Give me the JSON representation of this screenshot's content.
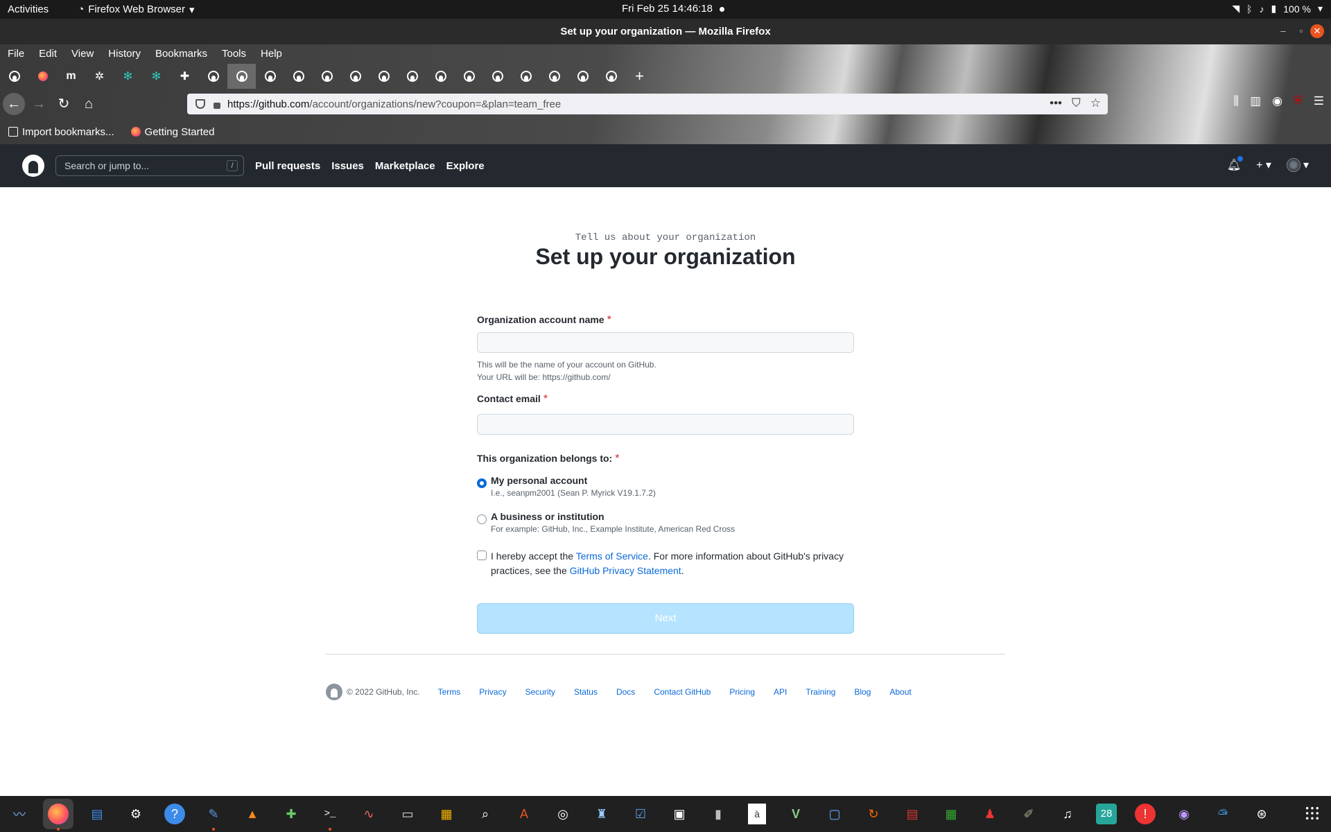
{
  "system": {
    "activities": "Activities",
    "app_name": "Firefox Web Browser",
    "clock": "Fri Feb 25  14:46:18",
    "battery": "100 %"
  },
  "window": {
    "title": "Set up your organization — Mozilla Firefox"
  },
  "menubar": [
    "File",
    "Edit",
    "View",
    "History",
    "Bookmarks",
    "Tools",
    "Help"
  ],
  "tabs": {
    "icons": [
      "github-icon",
      "firefox-icon",
      "medium-icon",
      "gear-icon",
      "snowflake-icon",
      "snowflake-icon",
      "puzzle-icon",
      "github-icon",
      "github-icon",
      "github-icon",
      "github-icon",
      "github-icon",
      "github-icon",
      "github-icon",
      "github-icon",
      "github-icon",
      "github-icon",
      "github-icon",
      "github-icon",
      "github-icon",
      "github-icon",
      "github-icon"
    ],
    "active_index": 8,
    "new_tab": "+"
  },
  "urlbar": {
    "host": "https://github.com",
    "path": "/account/organizations/new?coupon=&plan=team_free"
  },
  "bookmarks": [
    "Import bookmarks...",
    "Getting Started"
  ],
  "github_header": {
    "search_placeholder": "Search or jump to...",
    "search_key": "/",
    "nav": [
      "Pull requests",
      "Issues",
      "Marketplace",
      "Explore"
    ]
  },
  "page": {
    "subtitle": "Tell us about your organization",
    "title": "Set up your organization"
  },
  "form": {
    "org_name_label": "Organization account name",
    "org_name_value": "",
    "org_name_note1": "This will be the name of your account on GitHub.",
    "org_name_note2": "Your URL will be: https://github.com/",
    "email_label": "Contact email",
    "email_value": "",
    "belongs_label": "This organization belongs to:",
    "required_mark": "*",
    "option_personal_title": "My personal account",
    "option_personal_note": "I.e., seanpm2001 (Sean P. Myrick V19.1.7.2)",
    "option_business_title": "A business or institution",
    "option_business_note": "For example: GitHub, Inc., Example Institute, American Red Cross",
    "selected_option": "personal",
    "terms_pre": "I hereby accept the ",
    "terms_link": "Terms of Service",
    "terms_mid": ". For more information about GitHub's privacy practices, see the ",
    "privacy_link": "GitHub Privacy Statement",
    "terms_end": ".",
    "terms_checked": false,
    "next_button": "Next"
  },
  "footer": {
    "copyright": "© 2022 GitHub, Inc.",
    "links": [
      "Terms",
      "Privacy",
      "Security",
      "Status",
      "Docs",
      "Contact GitHub",
      "Pricing",
      "API",
      "Training",
      "Blog",
      "About"
    ]
  },
  "dock": {
    "calendar_day": "28",
    "apps": [
      "system-monitor-icon",
      "firefox-icon",
      "writer-icon",
      "settings-icon",
      "help-icon",
      "text-editor-icon",
      "vlc-icon",
      "puzzle-game-icon",
      "terminal-icon",
      "graph-icon",
      "files-icon",
      "calculator-icon",
      "image-viewer-icon",
      "software-store-icon",
      "disk-icon",
      "inkscape-icon",
      "todo-icon",
      "screenshot-icon",
      "archive-icon",
      "font-icon",
      "vim-icon",
      "remote-desktop-icon",
      "updater-icon",
      "document-viewer-icon",
      "spreadsheet-icon",
      "mario-icon",
      "gimp-icon",
      "music-icon",
      "calendar-icon",
      "alert-icon",
      "camera-icon",
      "weather-icon",
      "launcher-icon"
    ]
  }
}
